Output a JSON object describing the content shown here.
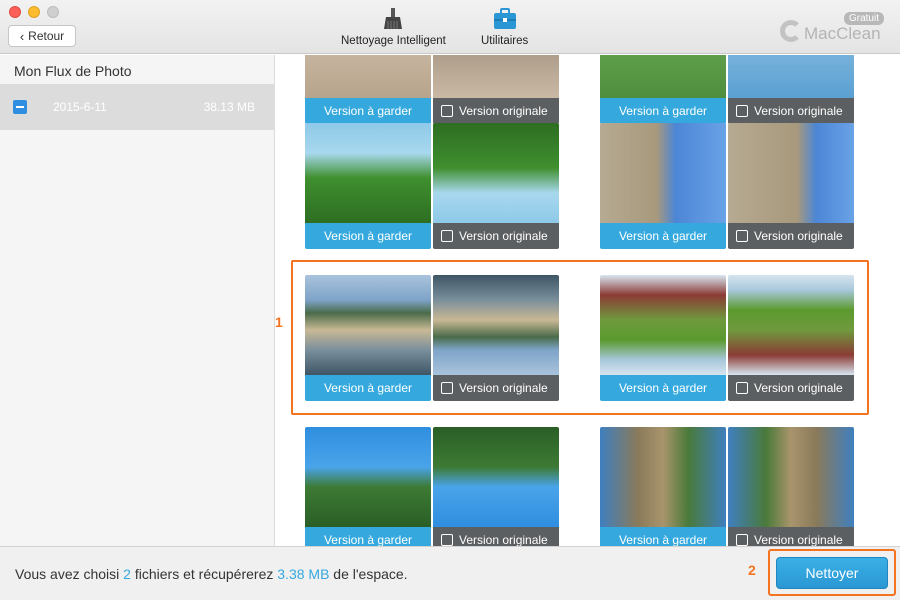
{
  "toolbar": {
    "back_label": "Retour",
    "tools": [
      {
        "label": "Nettoyage Intelligent",
        "icon": "broom-icon"
      },
      {
        "label": "Utilitaires",
        "icon": "toolbox-icon"
      }
    ],
    "brand": {
      "name": "MacClean",
      "badge": "Gratuit"
    }
  },
  "sidebar": {
    "header": "Mon Flux de Photo",
    "items": [
      {
        "date": "2015-6-11",
        "size": "38.13 MB",
        "checked": "partial"
      }
    ]
  },
  "grid": {
    "keep_label": "Version à garder",
    "original_label": "Version originale",
    "pairs": [
      {
        "subject": "top-left-partial"
      },
      {
        "subject": "top-right-partial"
      },
      {
        "subject": "forest-lake"
      },
      {
        "subject": "stone-ruins"
      },
      {
        "subject": "beach-coast"
      },
      {
        "subject": "park-path"
      },
      {
        "subject": "green-cliffs"
      },
      {
        "subject": "mountain-rock"
      }
    ]
  },
  "annotations": {
    "marker_1": "1",
    "marker_2": "2"
  },
  "footer": {
    "prefix": "Vous avez choisi ",
    "count": "2",
    "middle": " fichiers et récupérerez ",
    "amount": "3.38 MB",
    "suffix": " de l'espace.",
    "button": "Nettoyer"
  },
  "colors": {
    "accent": "#35a9dd",
    "highlight": "#f37321",
    "original_bar": "#5c5f61"
  }
}
